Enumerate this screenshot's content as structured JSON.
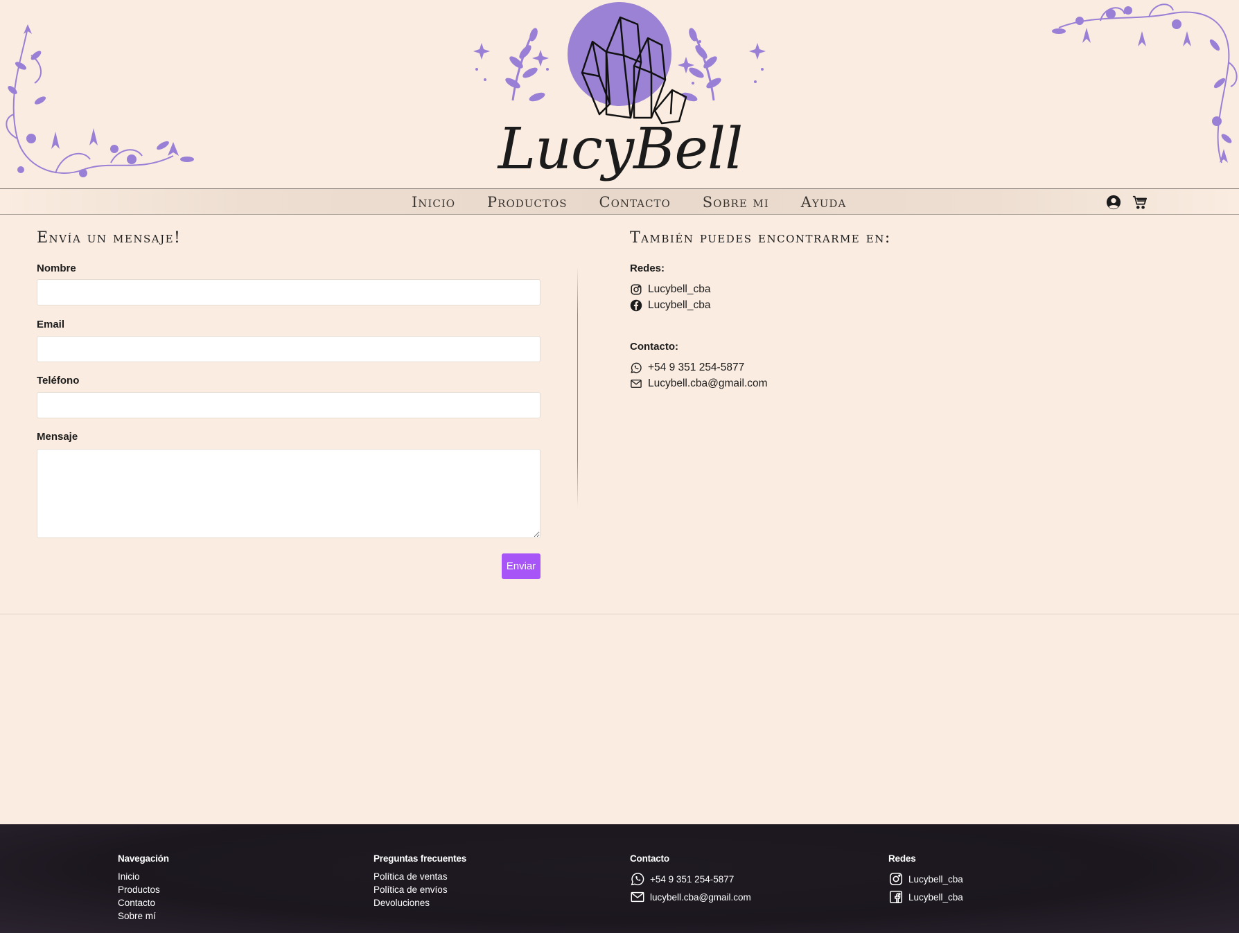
{
  "brand": {
    "name": "LucyBell"
  },
  "colors": {
    "background": "#faece0",
    "accent": "#a855f7",
    "floral": "#9a7fd6",
    "footer": "#1c171f"
  },
  "nav": {
    "items": [
      "Inicio",
      "Productos",
      "Contacto",
      "Sobre mi",
      "Ayuda"
    ],
    "icons": [
      "user-account-icon",
      "shopping-cart-icon"
    ]
  },
  "form": {
    "title": "Envía un mensaje!",
    "fields": {
      "name_label": "Nombre",
      "email_label": "Email",
      "phone_label": "Teléfono",
      "message_label": "Mensaje"
    },
    "submit_label": "Enviar"
  },
  "info": {
    "title": "También puedes encontrarme en:",
    "social_label": "Redes:",
    "instagram": "Lucybell_cba",
    "facebook": "Lucybell_cba",
    "contact_label": "Contacto:",
    "phone": "+54 9 351 254-5877",
    "email": "Lucybell.cba@gmail.com"
  },
  "footer": {
    "nav_title": "Navegación",
    "nav_links": [
      "Inicio",
      "Productos",
      "Contacto",
      "Sobre mí"
    ],
    "faq_title": "Preguntas frecuentes",
    "faq_links": [
      "Política de ventas",
      "Política de envíos",
      "Devoluciones"
    ],
    "contact_title": "Contacto",
    "phone": "+54 9 351 254-5877",
    "email": "lucybell.cba@gmail.com",
    "social_title": "Redes",
    "instagram": "Lucybell_cba",
    "facebook": "Lucybell_cba"
  }
}
